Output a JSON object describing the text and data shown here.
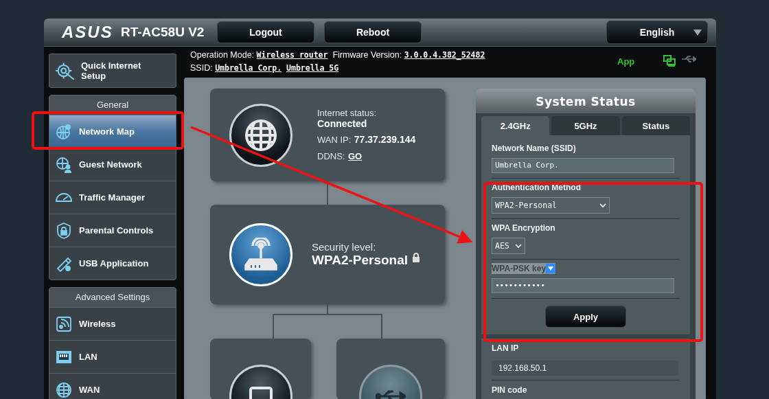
{
  "header": {
    "logo": "ASUS",
    "model": "RT-AC58U V2",
    "buttons": [
      "Logout",
      "Reboot"
    ],
    "language": "English"
  },
  "info": {
    "operation_mode_label": "Operation Mode:",
    "operation_mode": "Wireless router",
    "firmware_label": "Firmware Version:",
    "firmware": "3.0.0.4.382_52482",
    "ssid_label": "SSID:",
    "ssids": [
      "Umbrella Corp.",
      "Umbrella 5G"
    ],
    "app": "App"
  },
  "sidebar": {
    "quick_setup": "Quick Internet Setup",
    "groups": [
      {
        "title": "General",
        "items": [
          {
            "label": "Network Map",
            "selected": true
          },
          {
            "label": "Guest Network",
            "selected": false
          },
          {
            "label": "Traffic Manager",
            "selected": false
          },
          {
            "label": "Parental Controls",
            "selected": false
          },
          {
            "label": "USB Application",
            "selected": false
          }
        ]
      },
      {
        "title": "Advanced Settings",
        "items": [
          {
            "label": "Wireless",
            "selected": false
          },
          {
            "label": "LAN",
            "selected": false
          },
          {
            "label": "WAN",
            "selected": false
          }
        ]
      }
    ]
  },
  "network_map": {
    "internet": {
      "status_label": "Internet status:",
      "status": "Connected",
      "wan_label": "WAN IP:",
      "wan_ip": "77.37.239.144",
      "ddns_label": "DDNS:",
      "ddns_link": "GO"
    },
    "security": {
      "label": "Security level:",
      "value": "WPA2-Personal"
    }
  },
  "system_status": {
    "title": "System Status",
    "tabs": [
      {
        "label": "2.4GHz",
        "selected": true
      },
      {
        "label": "5GHz",
        "selected": false
      },
      {
        "label": "Status",
        "selected": false
      }
    ],
    "fields": [
      {
        "kind": "input",
        "label": "Network Name (SSID)",
        "value": "Umbrella Corp."
      },
      {
        "kind": "select",
        "label": "Authentication Method",
        "value": "WPA2-Personal"
      },
      {
        "kind": "select",
        "label": "WPA Encryption",
        "value": "AES"
      },
      {
        "kind": "key",
        "label": "WPA-PSK key",
        "value": "•••••••••••"
      }
    ],
    "apply": "Apply",
    "lan_ip_label": "LAN IP",
    "lan_ip": "192.168.50.1",
    "pin_label": "PIN code"
  }
}
